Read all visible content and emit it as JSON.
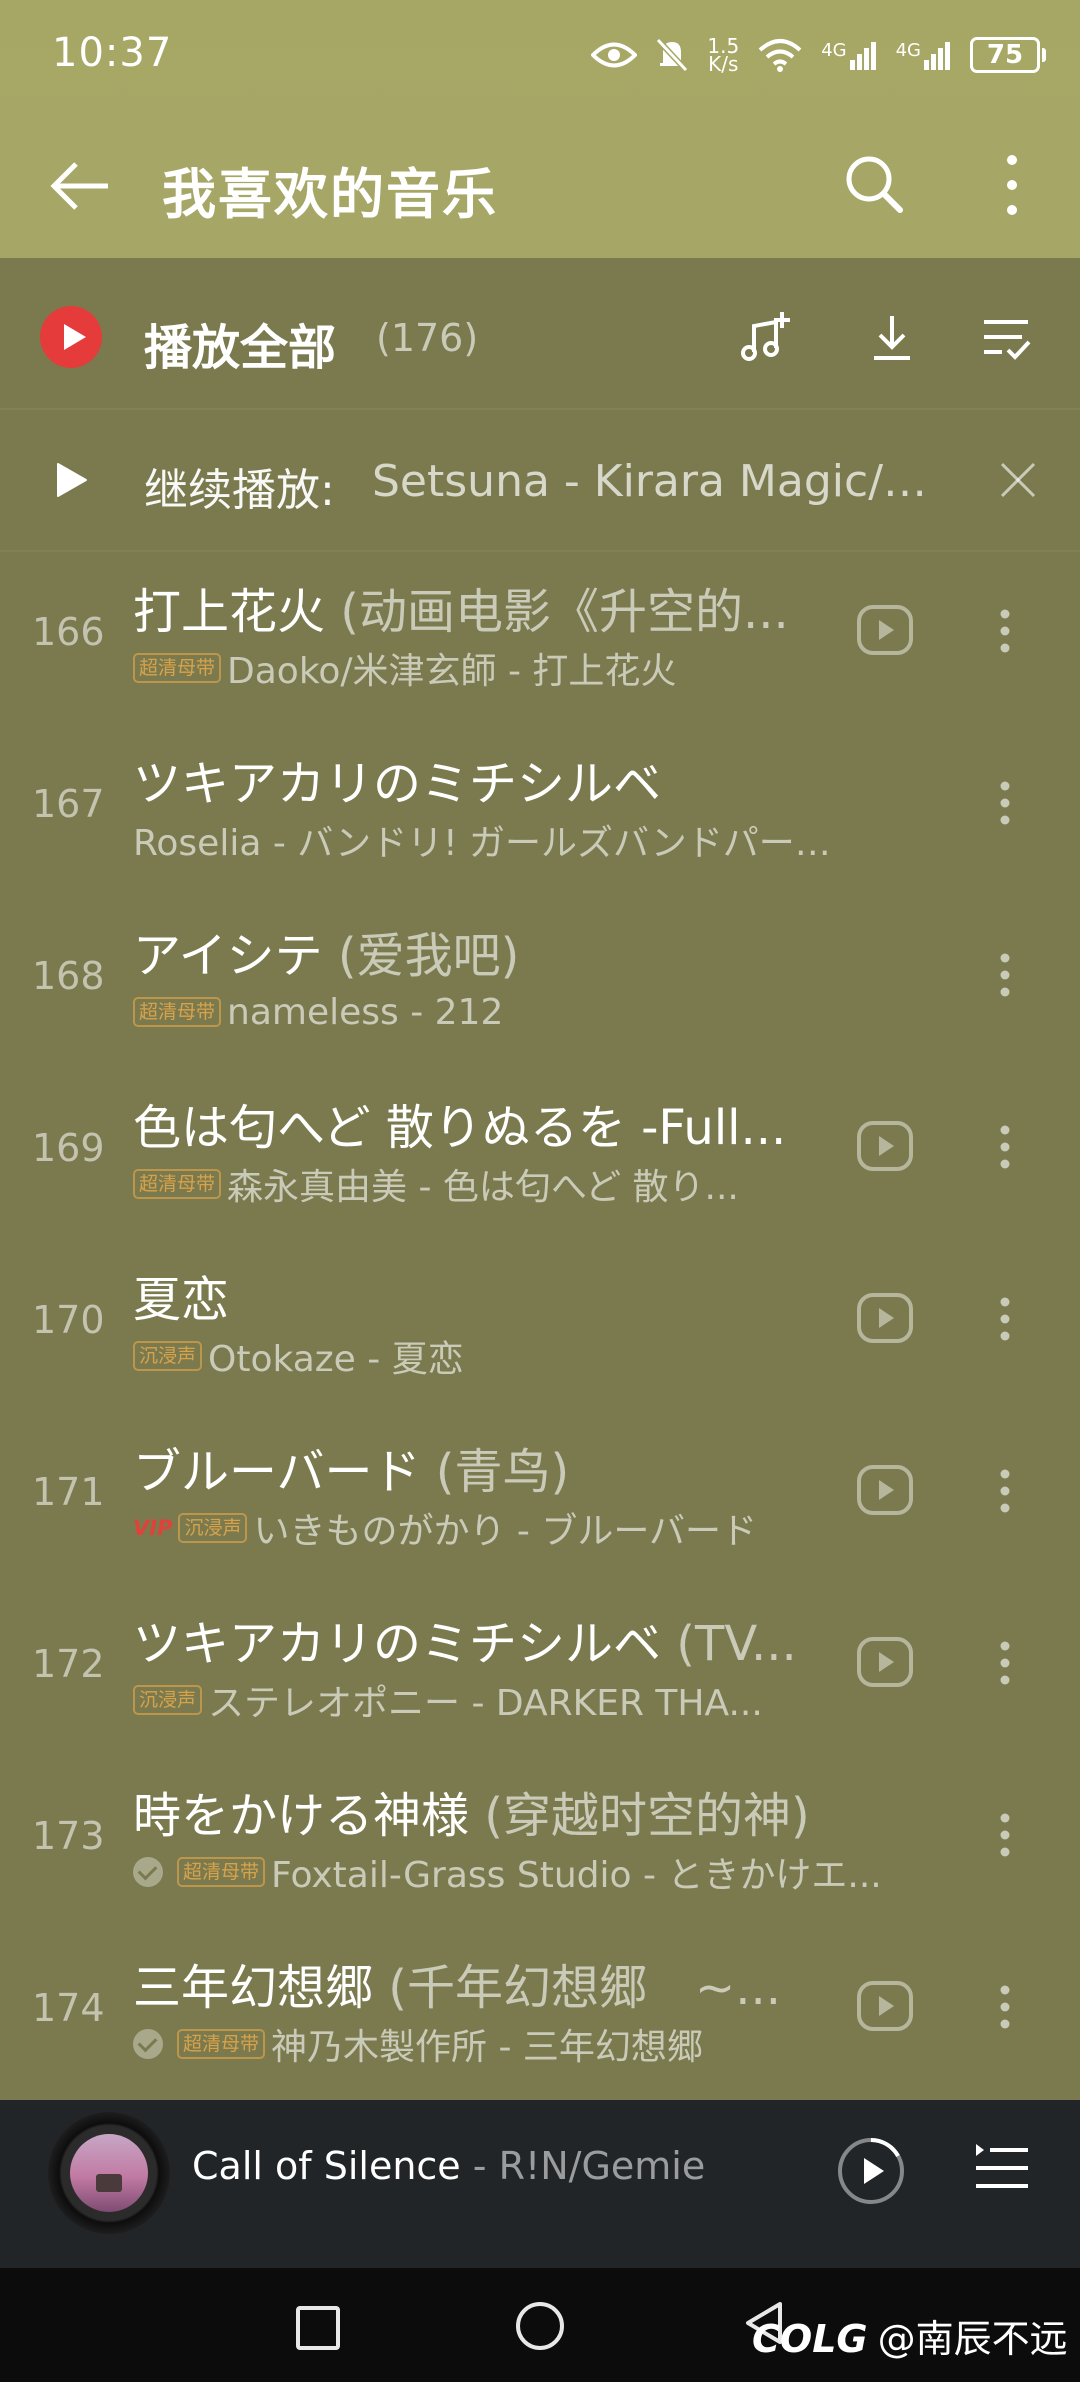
{
  "status_bar": {
    "time": "10:37",
    "net_speed_top": "1.5",
    "net_speed_bottom": "K/s",
    "signal1": "4G",
    "signal2": "4G",
    "battery": "75"
  },
  "header": {
    "title": "我喜欢的音乐"
  },
  "play_all": {
    "label": "播放全部",
    "count": "(176)"
  },
  "continue_bar": {
    "prefix": "继续播放:",
    "song": "Setsuna - Kirara Magic/X..."
  },
  "songs": [
    {
      "num": "166",
      "title": "打上花火",
      "alias": " (动画电影《升空的...",
      "badges": [
        "超清母带"
      ],
      "checked": false,
      "vip": false,
      "sub": "Daoko/米津玄師 - 打上花火",
      "mv": true
    },
    {
      "num": "167",
      "title": "ツキアカリのミチシルベ",
      "alias": "",
      "badges": [],
      "checked": false,
      "vip": false,
      "sub": "Roselia - バンドリ!  ガールズバンドパーテ...",
      "mv": false
    },
    {
      "num": "168",
      "title": "アイシテ",
      "alias": " (爱我吧)",
      "badges": [
        "超清母带"
      ],
      "checked": false,
      "vip": false,
      "sub": "nameless - 212",
      "mv": false
    },
    {
      "num": "169",
      "title": "色は匂へど 散りぬるを -Full...",
      "alias": "",
      "badges": [
        "超清母带"
      ],
      "checked": false,
      "vip": false,
      "sub": "森永真由美 - 色は匂へど 散り...",
      "mv": true
    },
    {
      "num": "170",
      "title": "夏恋",
      "alias": "",
      "badges": [
        "沉浸声"
      ],
      "checked": false,
      "vip": false,
      "sub": "Otokaze - 夏恋",
      "mv": true
    },
    {
      "num": "171",
      "title": "ブルーバード",
      "alias": " (青鸟)",
      "badges": [
        "沉浸声"
      ],
      "checked": false,
      "vip": true,
      "sub": "いきものがかり - ブルーバード",
      "mv": true
    },
    {
      "num": "172",
      "title": "ツキアカリのミチシルベ",
      "alias": " (TV...",
      "badges": [
        "沉浸声"
      ],
      "checked": false,
      "vip": false,
      "sub": "ステレオポニー - DARKER THA...",
      "mv": true
    },
    {
      "num": "173",
      "title": "時をかける神様",
      "alias": " (穿越时空的神)",
      "badges": [
        "超清母带"
      ],
      "checked": true,
      "vip": false,
      "sub": "Foxtail-Grass Studio - ときかけエ...",
      "mv": false
    },
    {
      "num": "174",
      "title": "三年幻想郷",
      "alias": " (千年幻想郷　~...",
      "badges": [
        "超清母带"
      ],
      "checked": true,
      "vip": false,
      "sub": "神乃木製作所 - 三年幻想郷",
      "mv": true
    }
  ],
  "vip_label": "VIP",
  "player": {
    "song": "Call of Silence",
    "artist": " - R!N/Gemie"
  },
  "watermark": {
    "logo": "COLG",
    "text": "@南辰不远"
  }
}
